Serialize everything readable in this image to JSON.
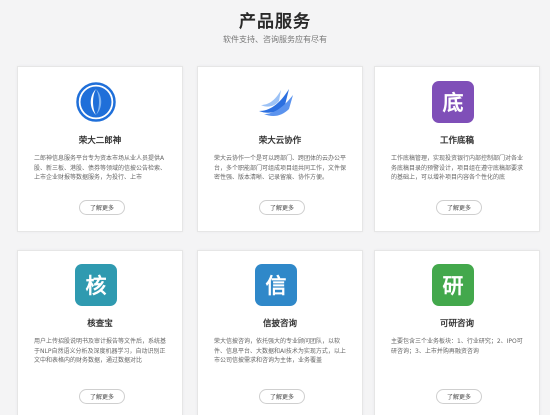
{
  "section": {
    "title": "产品服务",
    "subtitle": "软件支持、咨询服务应有尽有"
  },
  "cards": [
    {
      "name": "荣大二郎神",
      "icon": "erlangshen-logo-icon",
      "icon_color": "#1f6fd9",
      "desc": "二郎神信息服务平台专为资本市场从业人员提供A股、新三板、港股、债券等领域的信披公告检索、上市企业财报等数据服务，为投行、上市",
      "more": "了解更多"
    },
    {
      "name": "荣大云协作",
      "icon": "cloud-collab-logo-icon",
      "icon_color": "#2b6fe0",
      "desc": "荣大云协作一个是可以跨部门、跨团体的云办公平台，多个职能部门可组成项目组共同工作，文件保密性强、版本清晰、记录留痕、协作方便。",
      "more": "了解更多"
    },
    {
      "name": "工作底稿",
      "icon_text": "底",
      "icon_color": "#7f4fb8",
      "desc": "工作底稿管理，实现投资银行内部控制部门对各业务底稿目录的预警设计，项目组在遵守底稿部要求的基础上，可以增补项目内容各个性化的底",
      "more": "了解更多"
    },
    {
      "name": "核查宝",
      "icon_text": "核",
      "icon_color": "#2f9ab0",
      "desc": "用户上传招股说明书及审计报告等文件后，系统基于NLP自然语义分析及深度机器学习，自动识别正文中和表格内的财务数据，通过数据对比",
      "more": "了解更多"
    },
    {
      "name": "信披咨询",
      "icon_text": "信",
      "icon_color": "#2f88c9",
      "desc": "荣大信披咨询，依托强大的专业顾问团队，以软件、信息平台、大数据和AI技术为实现方式，以上市公司信披需求和咨询为主体，业务覆盖",
      "more": "了解更多"
    },
    {
      "name": "可研咨询",
      "icon_text": "研",
      "icon_color": "#43a84c",
      "desc": "主要包含三个业务板块：1、行业研究；2、IPO可研咨询；3、上市并购再融资咨询",
      "more": "了解更多"
    }
  ]
}
